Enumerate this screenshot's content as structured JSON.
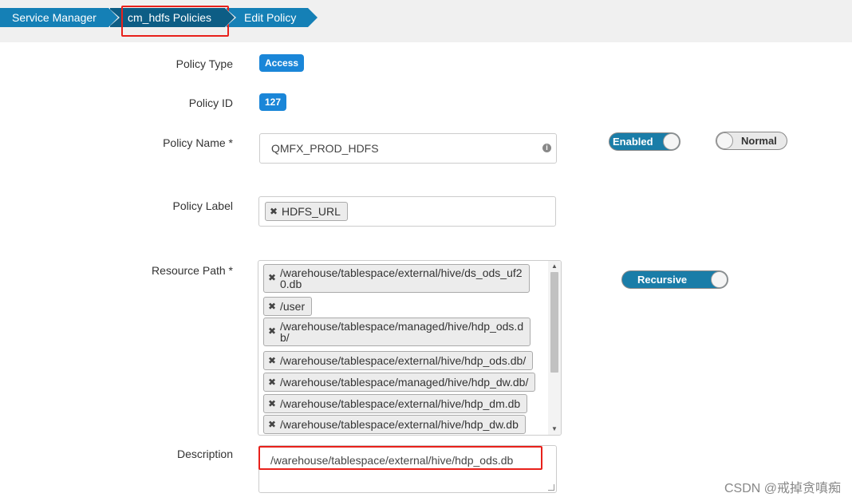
{
  "breadcrumb": {
    "items": [
      {
        "label": "Service Manager"
      },
      {
        "label": "cm_hdfs Policies"
      },
      {
        "label": "Edit Policy"
      }
    ]
  },
  "form": {
    "policy_type": {
      "label": "Policy Type",
      "value": "Access"
    },
    "policy_id": {
      "label": "Policy ID",
      "value": "127"
    },
    "policy_name": {
      "label": "Policy Name *",
      "value": "QMFX_PROD_HDFS"
    },
    "policy_label": {
      "label": "Policy Label",
      "tags": [
        "HDFS_URL"
      ]
    },
    "resource_path": {
      "label": "Resource Path *",
      "tags": [
        {
          "line1": "/warehouse/tablespace/external/hive/ds_ods_uf2",
          "line2": "0.db"
        },
        {
          "line1": "/user"
        },
        {
          "line1": "/warehouse/tablespace/managed/hive/hdp_ods.d",
          "line2": "b/"
        },
        {
          "line1": "/warehouse/tablespace/external/hive/hdp_ods.db/"
        },
        {
          "line1": "/warehouse/tablespace/managed/hive/hdp_dw.db/"
        },
        {
          "line1": "/warehouse/tablespace/external/hive/hdp_dm.db"
        },
        {
          "line1": "/warehouse/tablespace/external/hive/hdp_dw.db"
        }
      ]
    },
    "description": {
      "label": "Description",
      "value": "/warehouse/tablespace/external/hive/hdp_ods.db"
    }
  },
  "toggles": {
    "enabled": "Enabled",
    "normal": "Normal",
    "recursive": "Recursive"
  },
  "watermark": "CSDN @戒掉贪嗔痴",
  "colors": {
    "breadcrumb": "#1580b6",
    "breadcrumb_active": "#0d5d85",
    "badge": "#1a86d8",
    "highlight": "#e8211b",
    "toggle_on": "#1a7da8"
  }
}
